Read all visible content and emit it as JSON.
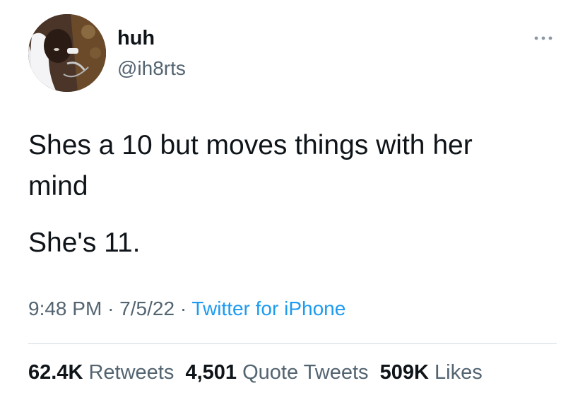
{
  "tweet": {
    "author": {
      "display_name": "huh",
      "handle": "@ih8rts",
      "avatar_icon": "profile-photo"
    },
    "more_icon": "more-horizontal-icon",
    "text_lines": [
      "Shes a 10 but moves things with her",
      "mind",
      "She's 11."
    ],
    "meta": {
      "time": "9:48 PM",
      "separator": "·",
      "date": "7/5/22",
      "source": "Twitter for iPhone"
    },
    "stats": {
      "retweets_count": "62.4K",
      "retweets_label": "Retweets",
      "quotes_count": "4,501",
      "quotes_label": "Quote Tweets",
      "likes_count": "509K",
      "likes_label": "Likes"
    },
    "colors": {
      "text_primary": "#0f1419",
      "text_secondary": "#536471",
      "link": "#1d9bf0",
      "divider": "#cfd9de"
    }
  }
}
